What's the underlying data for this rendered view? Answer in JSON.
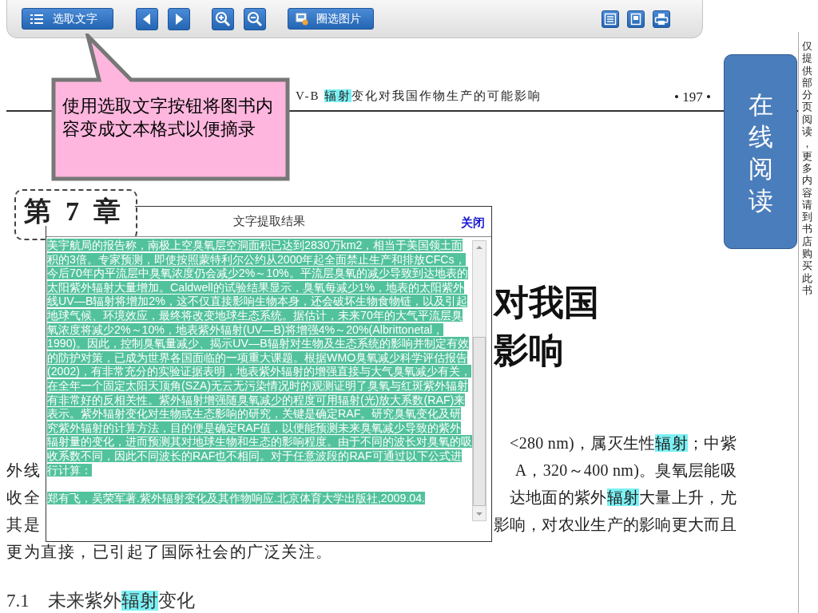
{
  "toolbar": {
    "buttons": [
      {
        "kind": "select_text",
        "label": "选取文字"
      },
      {
        "kind": "prev"
      },
      {
        "kind": "next"
      },
      {
        "kind": "zoom_in"
      },
      {
        "kind": "zoom_out"
      },
      {
        "kind": "select_image",
        "label": "圈选图片"
      },
      {
        "kind": "view_text"
      },
      {
        "kind": "view_page"
      },
      {
        "kind": "print"
      }
    ]
  },
  "callout": {
    "text": "使用选取文字按钮将图书内容变成文本格式以便摘录"
  },
  "page": {
    "header": {
      "title": [
        {
          "text": "V-B "
        },
        {
          "text": "辐射",
          "highlighted": true
        },
        {
          "text": "变化对我国作物生产的可能影响"
        }
      ],
      "page_number": "• 197 •"
    },
    "chapter_label": "第7章",
    "title_lines": [
      "对我国",
      "影响"
    ],
    "body_lines": [
      {
        "right": [
          {
            "text": "<280 nm)，属灭生性"
          },
          {
            "text": "辐射",
            "highlighted": true
          },
          {
            "text": "；中紫"
          }
        ]
      },
      {
        "left": [
          {
            "text": "外线"
          }
        ],
        "right": [
          {
            "text": "A，320～400 nm)。臭氧层能吸"
          }
        ]
      },
      {
        "left": [
          {
            "text": "收全"
          }
        ],
        "right": [
          {
            "text": "达地面的紫外"
          },
          {
            "text": "辐射",
            "highlighted": true
          },
          {
            "text": "大量上升，尤"
          }
        ]
      },
      {
        "left": [
          {
            "text": "其是"
          }
        ],
        "right": [
          {
            "text": "影响，对农业生产的影响更大而且"
          }
        ]
      },
      {
        "left": [
          {
            "text": "更为直接，已引起了国际社会的广泛关注。"
          }
        ]
      }
    ],
    "section_heading": [
      {
        "text": "7.1　未来紫外"
      },
      {
        "text": "辐射",
        "highlighted": true
      },
      {
        "text": "变化"
      }
    ]
  },
  "dialog": {
    "title": "文字提取结果",
    "close": "关闭",
    "selected": true,
    "paragraphs": [
      "美宇航局的报告称，南极上空臭氧层空洞面积已达到2830万km2，相当于美国领土面积的3倍。专家预测，即使按照蒙特利尔公约从2000年起全面禁止生产和排放CFCs，今后70年内平流层中臭氧浓度仍会减少2%～10%。平流层臭氧的减少导致到达地表的太阳紫外辐射大量增加。Caldwell的试验结果显示，臭氧每减少1%，地表的太阳紫外线UV—B辐射将增加2%，这不仅直接影响生物本身，还会破坏生物食物链，以及引起地球气候、环境效应，最终将改变地球生态系统。据估计，未来70年的大气平流层臭氧浓度将减少2%～10%，地表紫外辐射(UV—B)将增强4%～20%(Albrittonetal，1990)。因此，控制臭氧量减少、揭示UV—B辐射对生物及生态系统的影响并制定有效的防护对策，已成为世界各国面临的一项重大课题。根据WMO臭氧减少科学评估报告(2002)，有非常充分的实验证据表明，地表紫外辐射的增强直接与大气臭氧减少有关，在全年一个固定太阳天顶角(SZA)无云无污染情况时的观测证明了臭氧与红斑紫外辐射有非常好的反相关性。紫外辐射增强随臭氧减少的程度可用辐射(光)放大系数(RAF)来表示。紫外辐射变化对生物或生态影响的研究，关键是确定RAF。研究臭氧变化及研究紫外辐射的计算方法，目的便是确定RAF值，以便能预测未来臭氧减少导致的紫外辐射量的变化，进而预测其对地球生物和生态的影响程度。由于不同的波长对臭氧的吸收系数不同，因此不同波长的RAF也不相同。对于任意波段的RAF可通过以下公式进行计算：",
      "郑有飞，吴荣军著.紫外辐射变化及其作物响应.北京体育大学出版社,2009.04."
    ]
  },
  "side_panel": {
    "title": "在线阅读"
  },
  "notice": "仅提供部分页阅读，更多内容请到书店购买此书"
}
